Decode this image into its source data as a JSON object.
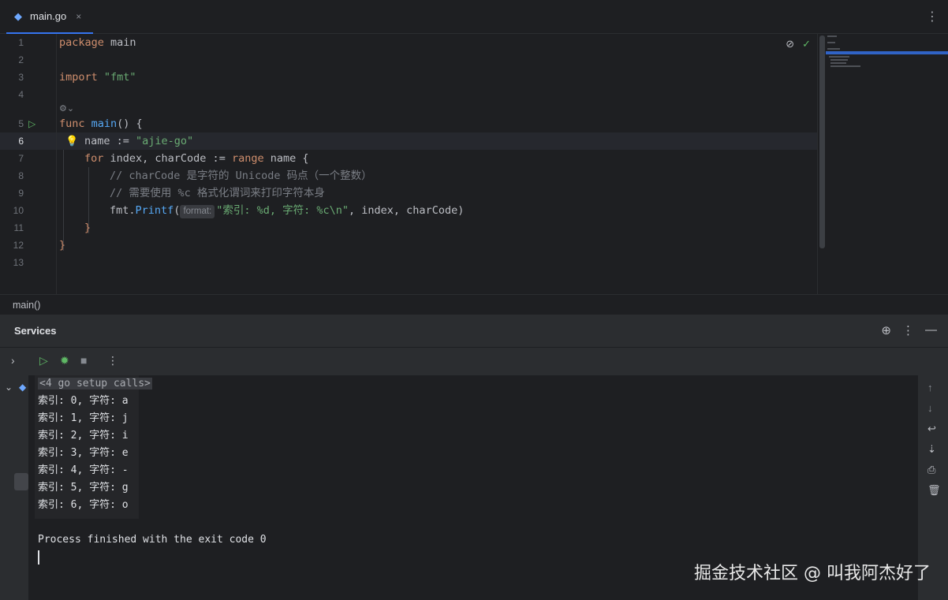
{
  "tab": {
    "label": "main.go",
    "close": "×"
  },
  "editor": {
    "line_numbers": [
      "1",
      "2",
      "3",
      "4",
      "5",
      "6",
      "7",
      "8",
      "9",
      "10",
      "11",
      "12",
      "13"
    ],
    "lines": {
      "l1_kw": "package",
      "l1_rest": " main",
      "l3_kw": "import",
      "l3_str": "\"fmt\"",
      "l5_kw": "func",
      "l5_fn": "main",
      "l5_rest": "() {",
      "l6_a": "name := ",
      "l6_str": "\"ajie-go\"",
      "l7_kw1": "for",
      "l7_a": " index, charCode := ",
      "l7_kw2": "range",
      "l7_b": " name {",
      "l8_cm": "// charCode 是字符的 Unicode 码点（一个整数）",
      "l9_cm": "// 需要使用 %c 格式化谓词来打印字符本身",
      "l10_a": "fmt.",
      "l10_fn": "Printf",
      "l10_b": "(",
      "l10_inlay": "format:",
      "l10_str": "\"索引: %d, 字符: %c\\n\"",
      "l10_c": ", index, charCode)",
      "l11": "}",
      "l12": "}"
    }
  },
  "breadcrumb": {
    "label": "main()"
  },
  "services": {
    "title": "Services",
    "console": {
      "setup_calls": "<4 go setup calls>",
      "lines": [
        "索引: 0, 字符: a",
        "索引: 1, 字符: j",
        "索引: 2, 字符: i",
        "索引: 3, 字符: e",
        "索引: 4, 字符: -",
        "索引: 5, 字符: g",
        "索引: 6, 字符: o"
      ],
      "exit": "Process finished with the exit code 0"
    }
  },
  "watermark": "掘金技术社区 @ 叫我阿杰好了"
}
